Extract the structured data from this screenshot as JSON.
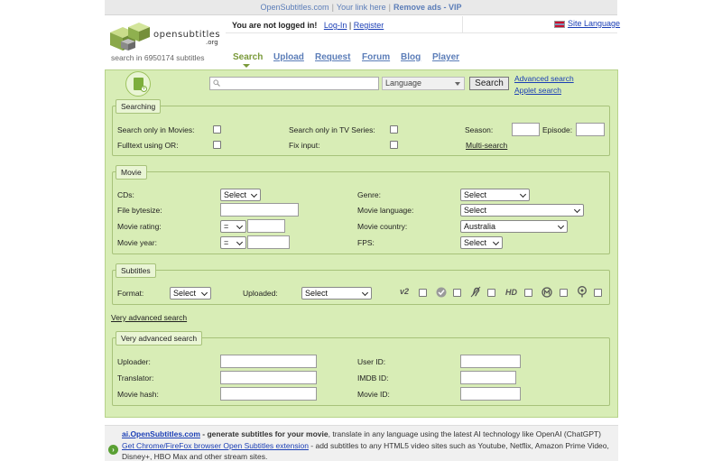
{
  "topbar": {
    "site_link": "OpenSubtitles.com",
    "your_link": "Your link here",
    "remove_ads": "Remove ads - VIP"
  },
  "header": {
    "logo_text": "opensubtitles",
    "logo_org": ".org",
    "subtitle_count": "search in 6950174 subtitles",
    "login_message": "You are not logged in!",
    "login_link": "Log-In",
    "register_link": "Register",
    "site_language": "Site Language"
  },
  "nav": {
    "items": [
      "Search",
      "Upload",
      "Request",
      "Forum",
      "Blog",
      "Player"
    ],
    "active": "Search"
  },
  "search": {
    "input_value": "",
    "language_select": "Language",
    "search_button": "Search",
    "advanced_link": "Advanced search",
    "applet_link": "Applet search"
  },
  "searching": {
    "legend": "Searching",
    "only_movies": "Search only in Movies:",
    "only_tv": "Search only in TV Series:",
    "season": "Season:",
    "episode": "Episode:",
    "fulltext": "Fulltext using OR:",
    "fix_input": "Fix input:",
    "multi_search": "Multi-search"
  },
  "movie": {
    "legend": "Movie",
    "cds_label": "CDs:",
    "cds_value": "Select",
    "genre_label": "Genre:",
    "genre_value": "Select",
    "bytesize_label": "File bytesize:",
    "movie_language_label": "Movie language:",
    "movie_language_value": "Select",
    "rating_label": "Movie rating:",
    "rating_op": "=",
    "country_label": "Movie country:",
    "country_value": "Australia",
    "year_label": "Movie year:",
    "year_op": "=",
    "fps_label": "FPS:",
    "fps_value": "Select"
  },
  "subtitles": {
    "legend": "Subtitles",
    "format_label": "Format:",
    "format_value": "Select",
    "uploaded_label": "Uploaded:",
    "uploaded_value": "Select",
    "icons": [
      "v2-icon",
      "trusted-check-icon",
      "hearing-impaired-icon",
      "hd-icon",
      "machine-translated-icon",
      "ai-icon"
    ],
    "v2_text": "v2",
    "hd_text": "HD"
  },
  "very_advanced_link": "Very advanced search",
  "very_advanced": {
    "legend": "Very advanced search",
    "uploader_label": "Uploader:",
    "userid_label": "User ID:",
    "translator_label": "Translator:",
    "imdb_label": "IMDB ID:",
    "moviehash_label": "Movie hash:",
    "movieid_label": "Movie ID:"
  },
  "promo": {
    "ai_link": "ai.OpenSubtitles.com",
    "ai_text_bold": " - generate subtitles for your movie",
    "ai_text": ", translate in any language using the latest AI technology like OpenAI (ChatGPT)",
    "ext_link": "Get Chrome/FireFox browser Open Subtitles extension",
    "ext_text": " - add subtitles to any HTML5 video sites such as Youtube, Netflix, Amazon Prime Video,",
    "ext_text2": "Disney+, HBO Max and other stream sites."
  },
  "colors": {
    "panel_bg": "#d8edb6",
    "link": "#1a3eb5",
    "nav_active": "#7a9a3a"
  }
}
